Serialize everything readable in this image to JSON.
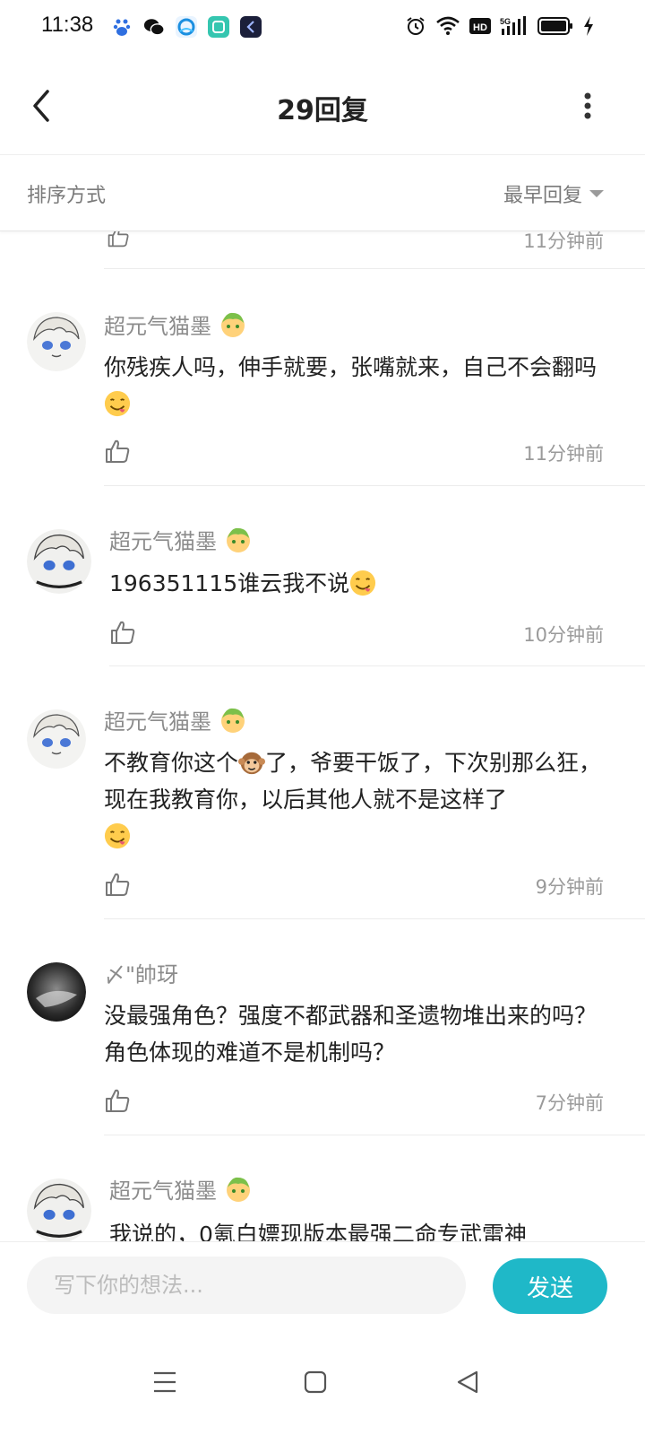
{
  "status_bar": {
    "time": "11:38",
    "icons": [
      "baidu-app-icon",
      "wechat-icon",
      "browser-icon",
      "app-icon",
      "app-icon",
      "alarm-icon",
      "wifi-icon",
      "hd-icon",
      "signal-5g-icon",
      "battery-icon",
      "charging-icon"
    ]
  },
  "header": {
    "title": "29回复"
  },
  "sort": {
    "label": "排序方式",
    "selected": "最早回复"
  },
  "partial_top": {
    "time": "11分钟前"
  },
  "replies": [
    {
      "name": "超元气猫墨",
      "text": "你残疾人吗，伸手就要，张嘴就来，自己不会翻吗",
      "has_emoji": true,
      "time": "11分钟前"
    },
    {
      "name": "超元气猫墨",
      "text": "196351115谁云我不说",
      "has_emoji": true,
      "time": "10分钟前"
    },
    {
      "name": "超元气猫墨",
      "text_a": "不教育你这个",
      "text_b": "了，爷要干饭了，下次别那么狂，现在我教育你，以后其他人就不是这样了",
      "has_emoji": true,
      "time": "9分钟前"
    },
    {
      "name": "〆\"帥玡",
      "text": "没最强角色？强度不都武器和圣遗物堆出来的吗？角色体现的难道不是机制吗？",
      "time": "7分钟前"
    },
    {
      "name": "超元气猫墨",
      "text": "我说的，0氪白嫖现版本最强二命专武雷神"
    }
  ],
  "composer": {
    "placeholder": "写下你的想法...",
    "send_label": "发送"
  },
  "colors": {
    "accent": "#1fb8c8",
    "text_primary": "#222222",
    "text_secondary": "#8c8c8c"
  }
}
